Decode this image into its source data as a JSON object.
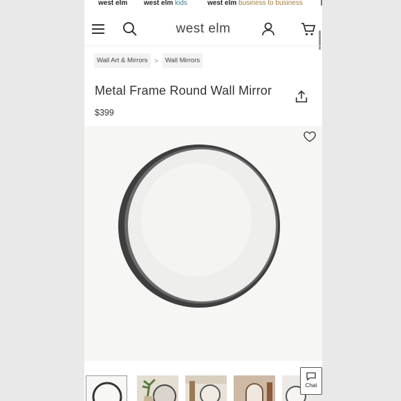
{
  "brandbar": {
    "brands": [
      {
        "name": "west elm",
        "sub": ""
      },
      {
        "name": "west elm",
        "sub": "kids"
      },
      {
        "name": "west elm",
        "sub": "business to business"
      }
    ]
  },
  "header": {
    "logo": "west elm",
    "icons": [
      "menu-icon",
      "search-icon",
      "account-icon",
      "cart-icon"
    ]
  },
  "breadcrumb": {
    "items": [
      "Wall Art & Mirrors",
      "Wall Mirrors"
    ],
    "separator": ">"
  },
  "product": {
    "title": "Metal Frame Round Wall Mirror",
    "price": "$399"
  },
  "gallery": {
    "thumbnails": [
      "round-mirror",
      "mirror-with-plant",
      "console-with-mirror",
      "arched-mirror",
      "hallway-mirror"
    ],
    "active_index": 0
  },
  "chat": {
    "label": "Chat"
  },
  "colors": {
    "frame": "#3f3f3f",
    "text": "#333333",
    "kids": "#3c7a8c",
    "business": "#a07a3a"
  }
}
